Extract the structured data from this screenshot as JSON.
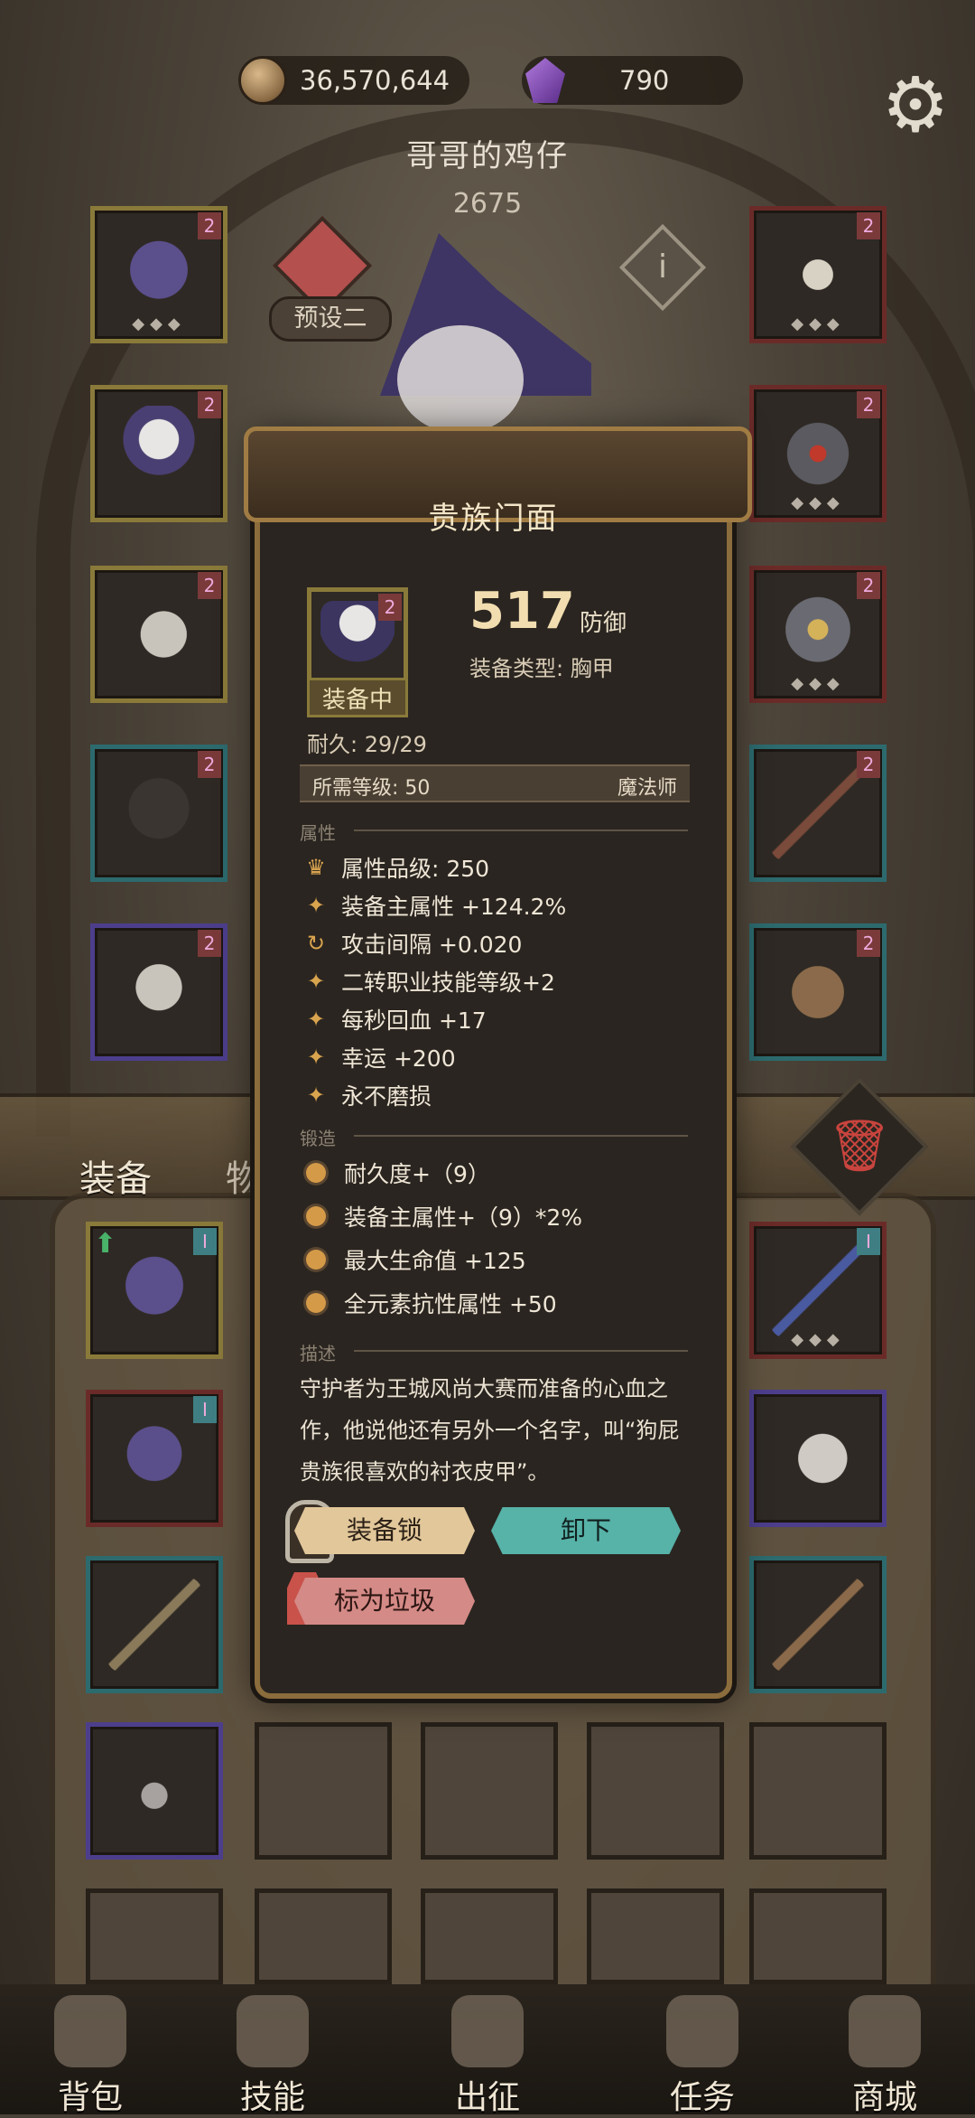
{
  "resources": {
    "coins": "36,570,644",
    "gems": "790"
  },
  "character": {
    "name": "哥哥的鸡仔",
    "score": "2675",
    "preset_label": "预设二"
  },
  "equip_slots_left": [
    {
      "slot": "hat",
      "frame": "gold",
      "badge": "2"
    },
    {
      "slot": "armor",
      "frame": "gold",
      "badge": "2"
    },
    {
      "slot": "gloves",
      "frame": "gold",
      "badge": "2"
    },
    {
      "slot": "pants",
      "frame": "teal",
      "badge": "2"
    },
    {
      "slot": "boots",
      "frame": "purple",
      "badge": "2"
    }
  ],
  "equip_slots_right": [
    {
      "slot": "amulet",
      "frame": "red",
      "badge": "2"
    },
    {
      "slot": "ring",
      "frame": "red",
      "badge": "2"
    },
    {
      "slot": "ring",
      "frame": "red",
      "badge": "2"
    },
    {
      "slot": "weapon",
      "frame": "teal",
      "badge": "2"
    },
    {
      "slot": "offhand",
      "frame": "teal",
      "badge": "2"
    }
  ],
  "tabs": {
    "equipment": "装备",
    "items": "物品"
  },
  "nav": [
    {
      "label": "背包",
      "icon": "backpack-icon"
    },
    {
      "label": "技能",
      "icon": "skill-book-icon"
    },
    {
      "label": "出征",
      "icon": "sword-icon"
    },
    {
      "label": "任务",
      "icon": "quest-icon"
    },
    {
      "label": "商城",
      "icon": "shop-crown-icon"
    }
  ],
  "popup": {
    "title": "贵族门面",
    "badge": "2",
    "equipped_tag": "装备中",
    "stat_value": "517",
    "stat_name": "防御",
    "item_type": "装备类型: 胸甲",
    "durability": "耐久: 29/29",
    "required_level": "所需等级: 50",
    "class": "魔法师",
    "sections": {
      "attributes": "属性",
      "forge": "锻造",
      "description": "描述"
    },
    "attributes": [
      {
        "icon": "grade-crown-icon",
        "text": "属性品级: 250"
      },
      {
        "icon": "star-icon",
        "text": "装备主属性 +124.2%"
      },
      {
        "icon": "refresh-icon",
        "text": "攻击间隔 +0.020"
      },
      {
        "icon": "star-icon",
        "text": "二转职业技能等级+2"
      },
      {
        "icon": "star-icon",
        "text": "每秒回血 +17"
      },
      {
        "icon": "star-icon",
        "text": "幸运 +200"
      },
      {
        "icon": "star-icon",
        "text": "永不磨损"
      }
    ],
    "forge": [
      "耐久度+（9）",
      "装备主属性+（9）*2%",
      "最大生命值 +125",
      "全元素抗性属性 +50"
    ],
    "description": "守护者为王城风尚大赛而准备的心血之作，他说他还有另外一个名字，叫“狗屁贵族很喜欢的衬衣皮甲”。",
    "buttons": {
      "lock": "装备锁",
      "unequip": "卸下",
      "mark_trash": "标为垃圾"
    }
  },
  "colors": {
    "accent_gold": "#8b6c3c",
    "unequip_btn": "#57b2a8",
    "lock_btn": "#e2c79a",
    "trash_btn": "#d48a86"
  }
}
